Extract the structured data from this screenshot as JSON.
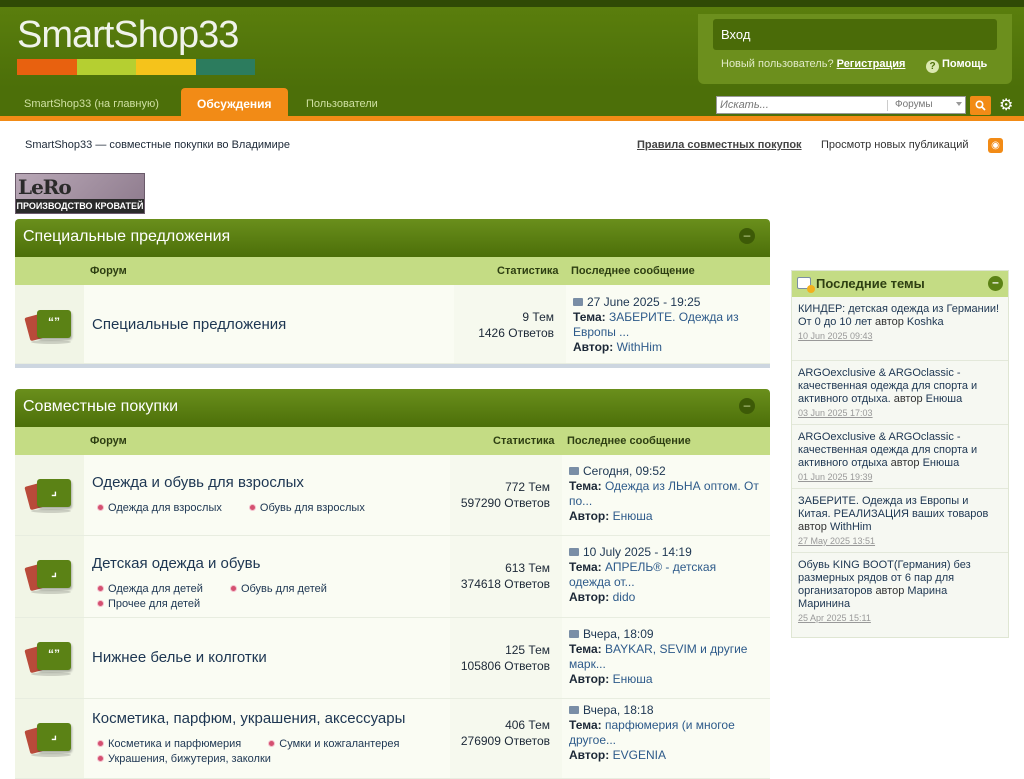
{
  "header": {
    "logo_text": "SmartShop33",
    "logo_bar_colors": [
      "#e8610f",
      "#b5cf31",
      "#f5c31b",
      "#2c7c5e"
    ],
    "login_label": "Вход",
    "new_user_text": "Новый пользователь?",
    "register_label": "Регистрация",
    "help_label": "Помощь"
  },
  "nav": {
    "tabs": [
      {
        "label": "SmartShop33 (на главную)"
      },
      {
        "label": "Обсуждения",
        "active": true
      },
      {
        "label": "Пользователи"
      }
    ],
    "search_placeholder": "Искать...",
    "search_scope": "Форумы"
  },
  "toolbar": {
    "breadcrumb": "SmartShop33 — совместные покупки во Владимире",
    "rules_link": "Правила совместных покупок",
    "new_posts_link": "Просмотр новых публикаций"
  },
  "banner": {
    "brand": "LeRo",
    "subtitle": "ПРОИЗВОДСТВО КРОВАТЕЙ"
  },
  "columns": {
    "forum": "Форум",
    "stats": "Статистика",
    "last_post": "Последнее сообщение",
    "topic_label": "Тема:",
    "author_label": "Автор:"
  },
  "categories": [
    {
      "title": "Специальные предложения",
      "forums": [
        {
          "name": "Специальные предложения",
          "topics": "9 Тем",
          "replies": "1426 Ответов",
          "last_date": "27 June 2025 - 19:25",
          "last_topic": "ЗАБЕРИТЕ. Одежда из Европы ...",
          "last_author": "WithHim"
        }
      ]
    },
    {
      "title": "Совместные покупки",
      "forums": [
        {
          "name": "Одежда и обувь для взрослых",
          "subforums": [
            "Одежда для взрослых",
            "Обувь для взрослых"
          ],
          "topics": "772 Тем",
          "replies": "597290 Ответов",
          "last_date": "Сегодня, 09:52",
          "last_topic": "Одежда из ЛЬНА оптом. От по...",
          "last_author": "Енюша"
        },
        {
          "name": "Детская одежда и обувь",
          "subforums": [
            "Одежда для детей",
            "Обувь для детей",
            "Прочее для детей"
          ],
          "topics": "613 Тем",
          "replies": "374618 Ответов",
          "last_date": "10 July 2025 - 14:19",
          "last_topic": "АПРЕЛЬ® - детская одежда от...",
          "last_author": "dido"
        },
        {
          "name": "Нижнее белье и колготки",
          "topics": "125 Тем",
          "replies": "105806 Ответов",
          "last_date": "Вчера, 18:09",
          "last_topic": "BAYKAR, SEVIM и другие марк...",
          "last_author": "Енюша"
        },
        {
          "name": "Косметика, парфюм, украшения, аксессуары",
          "subforums": [
            "Косметика и парфюмерия",
            "Сумки и кожгалантерея",
            "Украшения, бижутерия, заколки"
          ],
          "topics": "406 Тем",
          "replies": "276909 Ответов",
          "last_date": "Вчера, 18:18",
          "last_topic": "парфюмерия (и многое другое...",
          "last_author": "EVGENIA"
        }
      ]
    }
  ],
  "sidebar": {
    "title": "Последние темы",
    "by_label": "автор",
    "topics": [
      {
        "title": "КИНДЕР: детская одежда из Германии! От 0 до 10 лет",
        "author": "Koshka",
        "date": "10 Jun 2025 09:43"
      },
      {
        "title": "ARGOexclusive & ARGOclassic - качественная одежда для спорта и активного отдыха.",
        "author": "Енюша",
        "date": "03 Jun 2025 17:03"
      },
      {
        "title": "ARGOexclusive & ARGOclassic - качественная одежда для спорта и активного отдыха",
        "author": "Енюша",
        "date": "01 Jun 2025 19:39"
      },
      {
        "title": "ЗАБЕРИТЕ. Одежда из Европы и Китая. РЕАЛИЗАЦИЯ ваших товаров",
        "author": "WithHim",
        "date": "27 May 2025 13:51"
      },
      {
        "title": "Обувь KING BOOT(Германия) без размерных рядов от 6 пар для организаторов",
        "author": "Марина Маринина",
        "date": "25 Apr 2025 15:11"
      }
    ]
  }
}
